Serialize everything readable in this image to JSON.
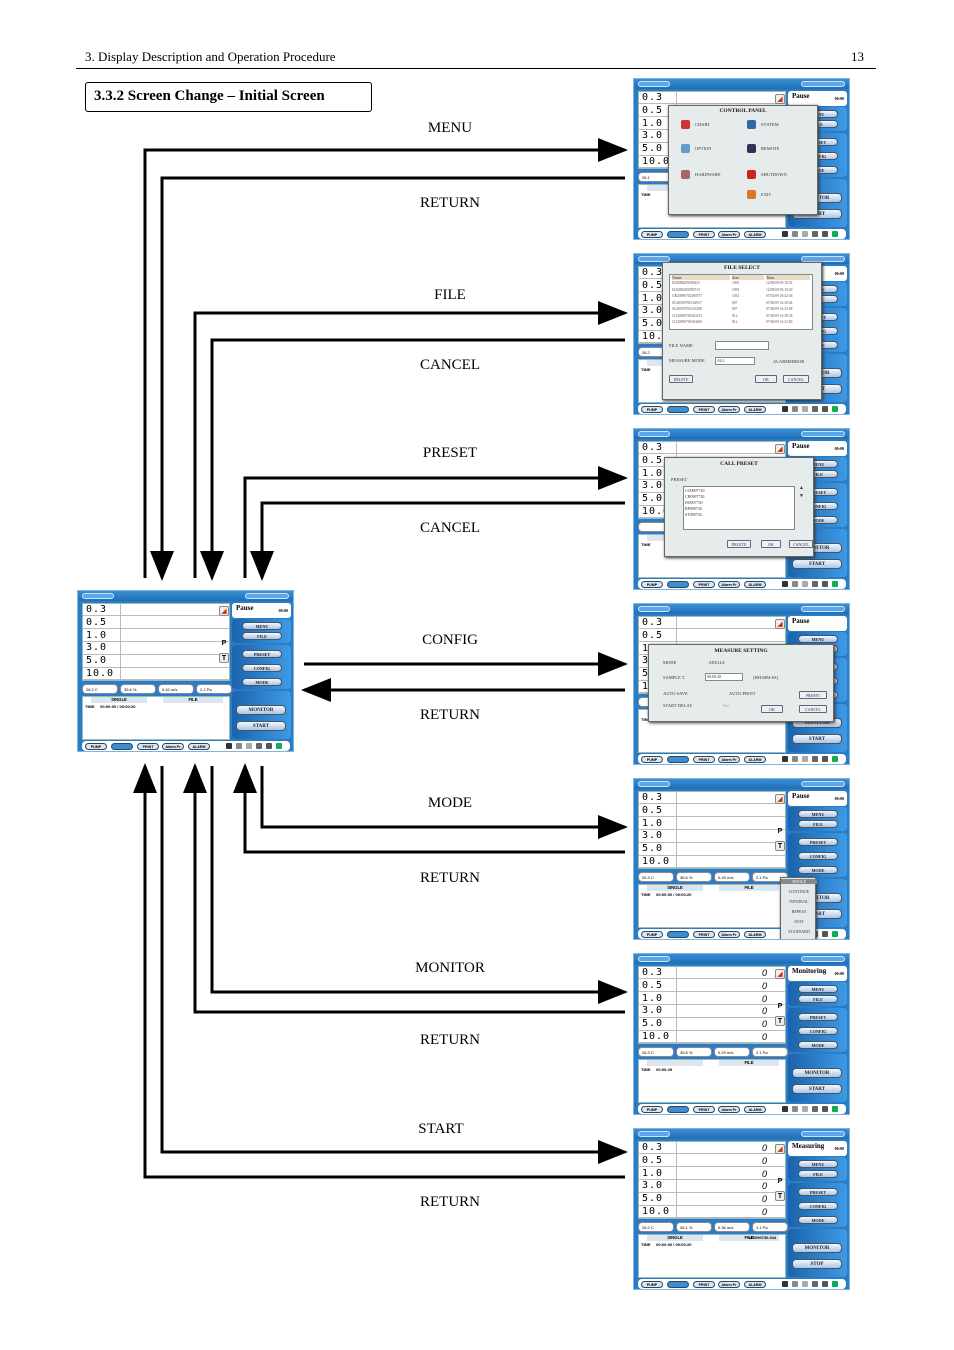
{
  "header": {
    "chapter": "3. Display Description and Operation Procedure",
    "page_number": "13"
  },
  "section_title": "3.3.2 Screen Change – Initial Screen",
  "flow_labels": {
    "menu": "MENU",
    "menu_return": "RETURN",
    "file": "FILE",
    "file_cancel": "CANCEL",
    "preset": "PRESET",
    "preset_cancel": "CANCEL",
    "config": "CONFIG",
    "config_return": "RETURN",
    "mode": "MODE",
    "mode_return": "RETURN",
    "monitor": "MONITOR",
    "monitor_return": "RETURN",
    "start": "START",
    "start_return": "RETURN"
  },
  "device": {
    "sizes": [
      "0.3",
      "0.5",
      "1.0",
      "3.0",
      "5.0",
      "10.0"
    ],
    "p_label": "P",
    "t_label": "T",
    "buttons": [
      "MENU",
      "FILE",
      "PRESET",
      "CONFIG",
      "MODE",
      "MONITOR",
      "START"
    ],
    "stop": "STOP",
    "bottom": [
      "PUMP",
      "LIVE",
      "PRINT",
      "Alarm Pr",
      "ALARM"
    ],
    "time_label": "TIME",
    "file_label": "FILE"
  },
  "screens": {
    "initial": {
      "status": "Pause",
      "clock": "00:00",
      "mode": "SINGLE",
      "time": "00:00:00 / 00:00:20",
      "readings": [
        "26.2 C",
        "35.6 %",
        "0.42 m/s",
        "2.1 Pa"
      ]
    },
    "menu": {
      "status": "Pause",
      "clock": "00:00",
      "mode": "",
      "time": "",
      "readings": [
        "26.1",
        "",
        "",
        ""
      ]
    },
    "file": {
      "status": "Pause",
      "clock": "00:00",
      "mode": "",
      "time": "",
      "readings": [
        "26.2",
        "",
        "",
        ""
      ]
    },
    "preset": {
      "status": "Pause",
      "clock": "00:00",
      "mode": "",
      "time": "",
      "readings": [
        "",
        "",
        "",
        ""
      ]
    },
    "config": {
      "status": "Pause",
      "clock": "",
      "mode": "",
      "time": "",
      "readings": [
        "",
        "",
        "",
        ""
      ]
    },
    "mode": {
      "status": "Pause",
      "clock": "00:00",
      "mode": "SINGLE",
      "time": "00:00:00 / 00:00:20",
      "readings": [
        "26.3 C",
        "36.6 %",
        "0-40 m/s",
        "2.1 Pa"
      ]
    },
    "monitor": {
      "status": "Monitoring",
      "clock": "00:00",
      "mode": "",
      "time": "00:00:25",
      "counts": "0",
      "readings": [
        "26.3 C",
        "35.6 %",
        "0.29 m/s",
        "2.1 Pa"
      ]
    },
    "start": {
      "status": "Measuring",
      "clock": "00:00",
      "mode": "SINGLE",
      "time": "00:00:00 / 00:00:20",
      "counts": "0",
      "filename": "MS090730.044",
      "readings": [
        "26.2 C",
        "36.1 %",
        "0.36 m/s",
        "1.1 Pa"
      ]
    }
  },
  "control_panel": {
    "title": "CONTROL PANEL",
    "items": [
      "CHART",
      "SYSTEM",
      "OPTION",
      "REMOTE",
      "HARDWARE",
      "SHUTDOWN",
      "EXIT"
    ]
  },
  "file_select": {
    "title": "FILE SELECT",
    "columns": [
      "Name",
      "Size",
      "Time"
    ],
    "rows": [
      [
        "IS2008I209090443",
        "1993",
        "12/09/08 09:18:52"
      ],
      [
        "IS2008I209090719",
        "1993",
        "12/09/08 09:19:20"
      ],
      [
        "GR20090702380757",
        "1052",
        "07/02/09 18:42:36"
      ],
      [
        "SG20090706162957",
        "807",
        "07/06/09 16:30:04"
      ],
      [
        "SG20090706163308",
        "807",
        "07/06/09 16:33:08"
      ],
      [
        "CO20090706163155",
        "812",
        "07/06/09 16:38:38"
      ],
      [
        "CO20090706163630",
        "812",
        "07/06/09 16:33:00"
      ]
    ],
    "file_name_label": "FILE NAME",
    "measure_mode_label": "MEASURE MODE",
    "measure_mode_value": "ALL",
    "alarm_error": "ALARMERROR",
    "delete": "DELETE",
    "ok": "OK",
    "cancel": "CANCEL"
  },
  "call_preset": {
    "title": "CALL PRESET",
    "label": "PRESET",
    "items": [
      "CO0907730",
      "CR0907730",
      "IS0907730",
      "RP090730",
      "ST090730"
    ],
    "delete": "DELETE",
    "ok": "OK",
    "cancel": "CANCEL"
  },
  "measure_setting": {
    "title": "MEASURE SETTING",
    "mode_label": "MODE",
    "mode_value": "SINGLE",
    "sample_label": "SAMPLE T.",
    "sample_value": "00:00:20",
    "sample_unit": "(HH:MM:SS)",
    "auto_save": "AUTO SAVE",
    "auto_print": "AUTO PRINT",
    "start_delay": "START DELAY",
    "delay_unit": "Sec",
    "preset": "PRESET",
    "ok": "OK",
    "cancel": "CANCEL"
  },
  "mode_menu": {
    "items": [
      "SINGLE",
      "CONTINUE",
      "INTERVAL",
      "REPEAT",
      "STAT",
      "STANDARD"
    ],
    "selected": "SINGLE"
  },
  "colors": {
    "device_blue": "#2a7cc4",
    "panel_gray": "#e6ecec"
  }
}
